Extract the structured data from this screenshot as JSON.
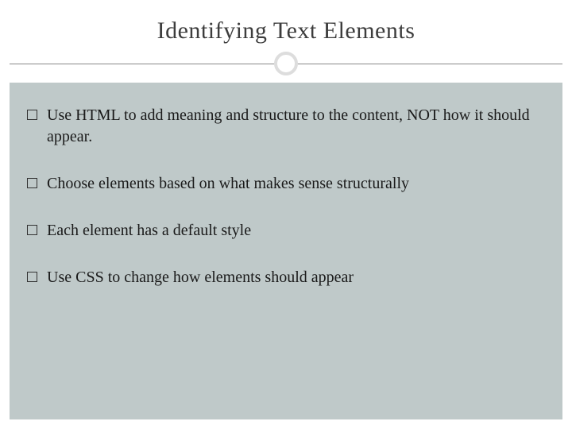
{
  "slide": {
    "title": "Identifying Text Elements",
    "bullets": [
      "Use HTML to add meaning and structure to the content, NOT how it should appear.",
      "Choose elements based on what makes sense structurally",
      "Each element has a default style",
      "Use CSS to change how elements should appear"
    ]
  }
}
